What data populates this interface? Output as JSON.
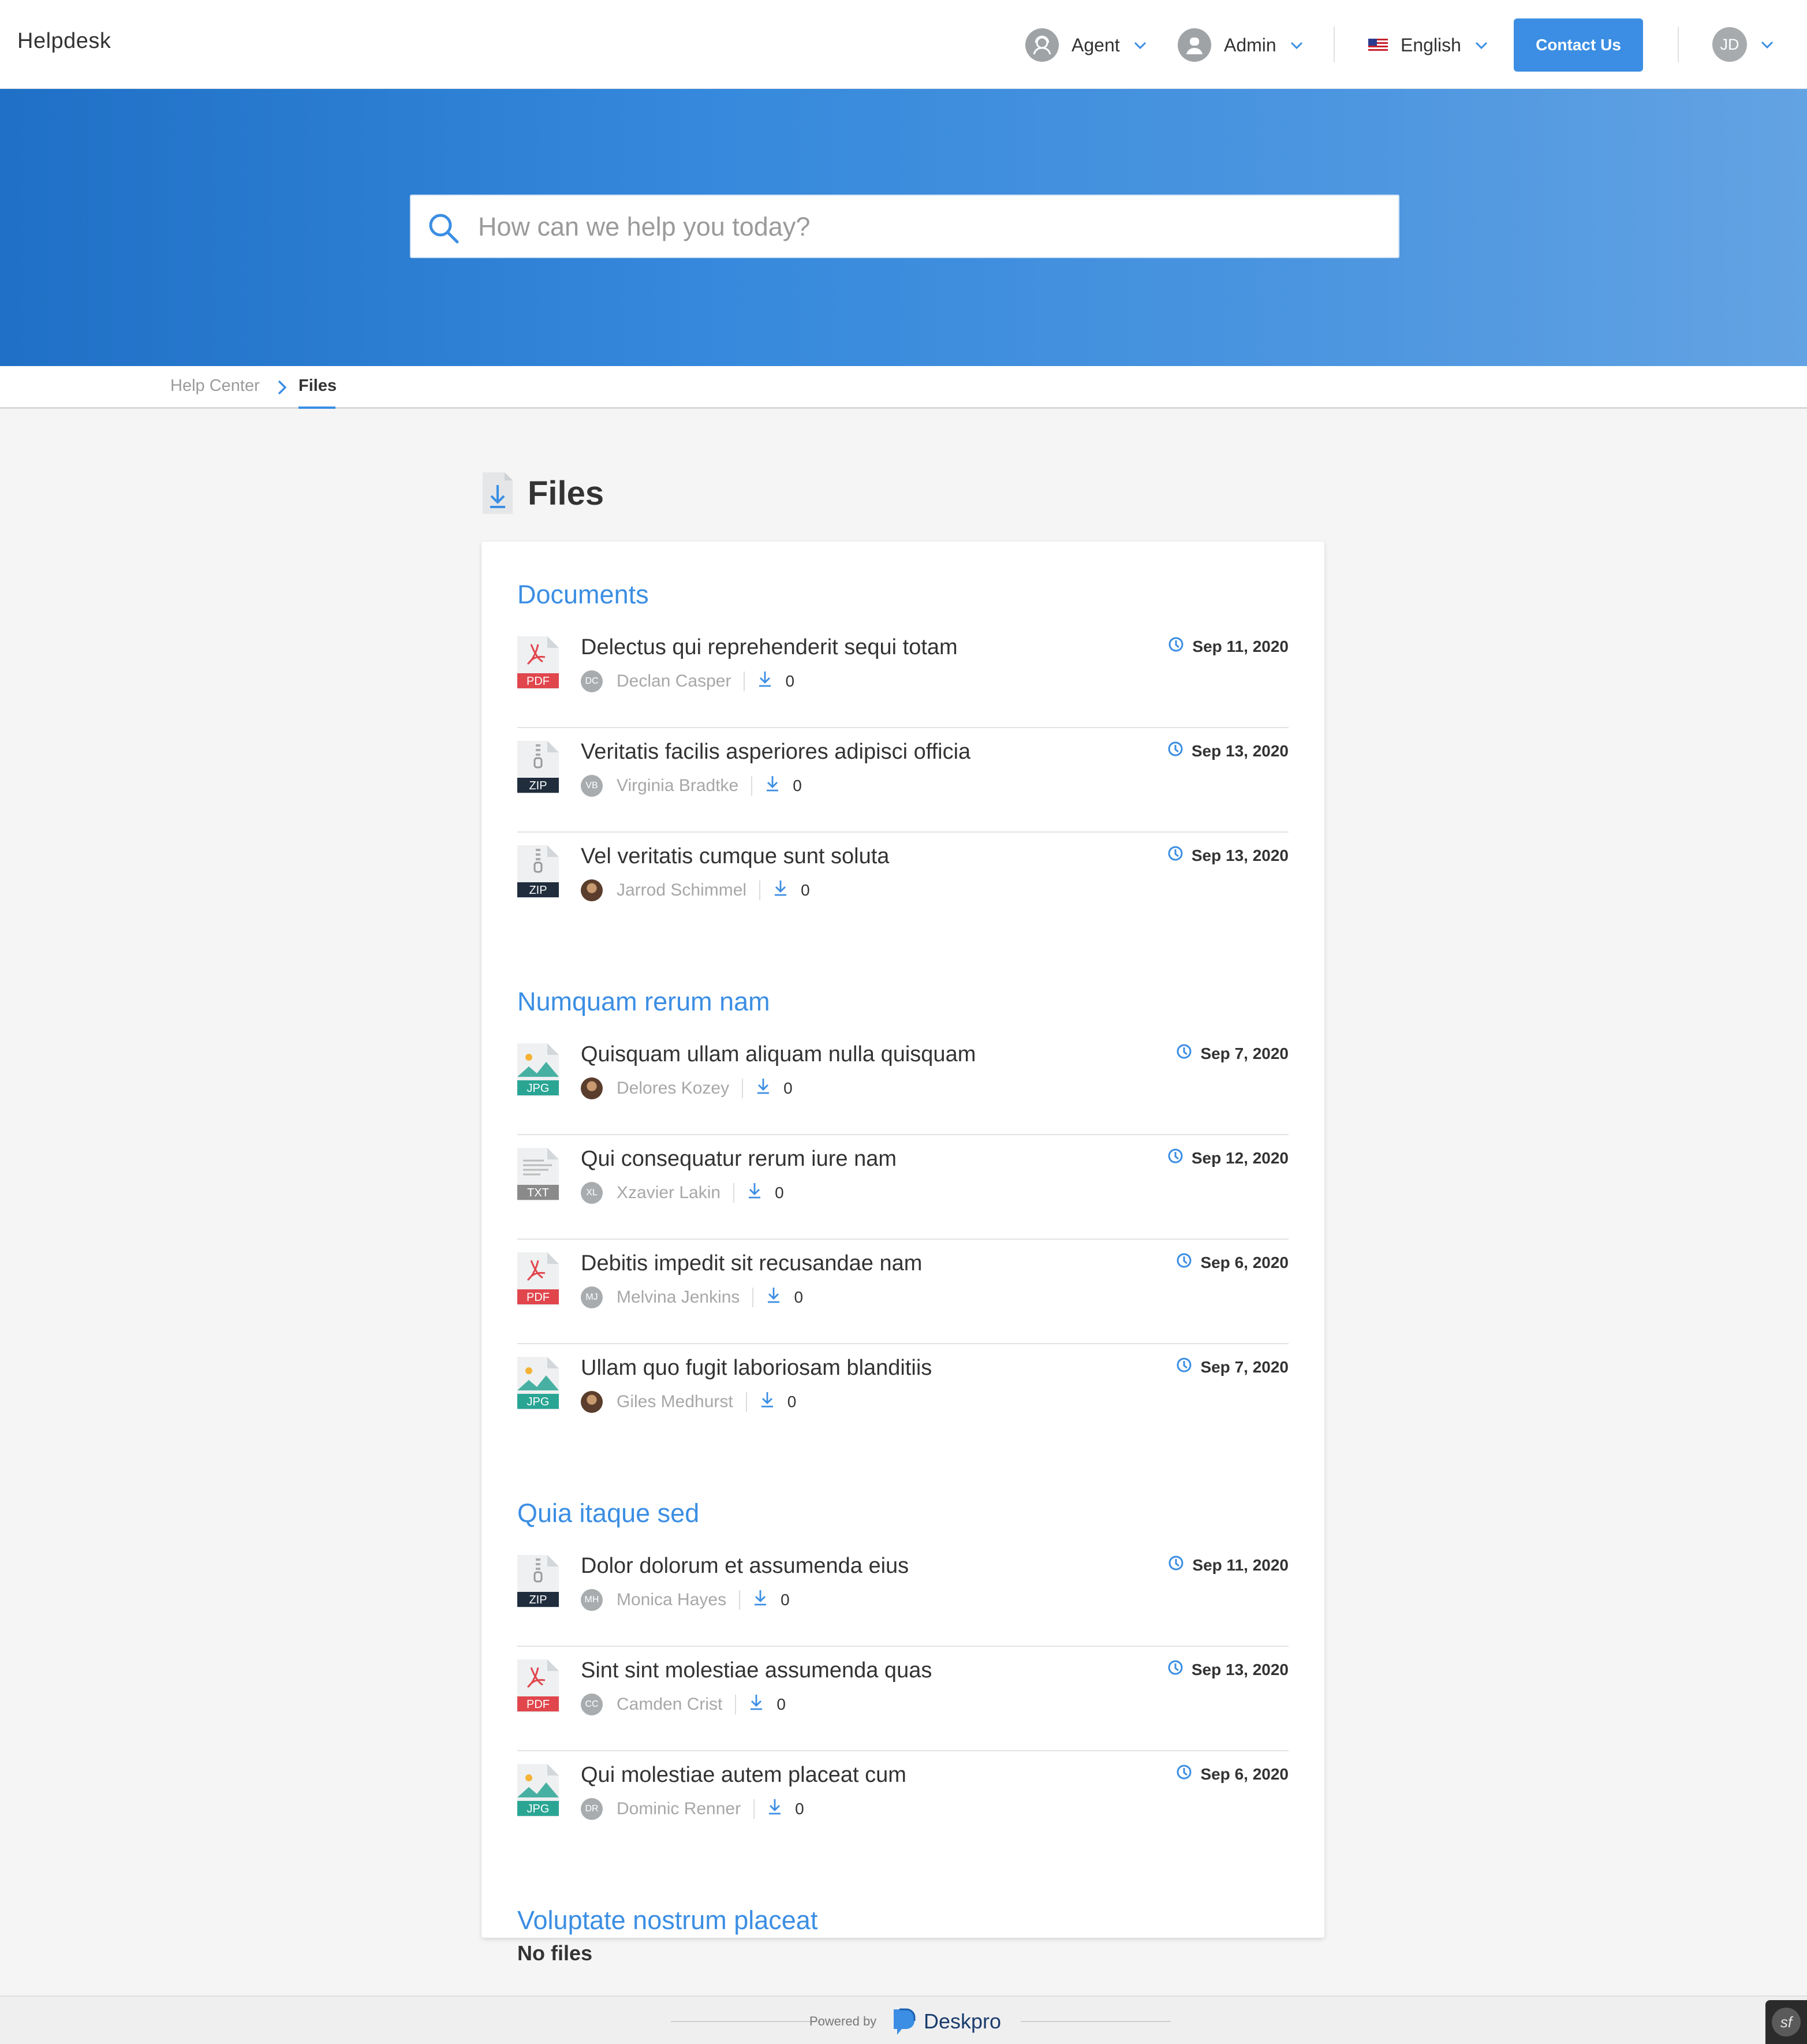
{
  "header": {
    "brand": "Helpdesk",
    "agent_label": "Agent",
    "admin_label": "Admin",
    "language_label": "English",
    "contact_label": "Contact Us",
    "user_initials": "JD"
  },
  "search": {
    "placeholder": "How can we help you today?"
  },
  "breadcrumb": {
    "home": "Help Center",
    "current": "Files"
  },
  "page": {
    "title": "Files"
  },
  "sections": [
    {
      "title": "Documents",
      "files": [
        {
          "title": "Delectus qui reprehenderit sequi totam",
          "type": "PDF",
          "author": "Declan Casper",
          "initials": "DC",
          "downloads": "0",
          "date": "Sep 11, 2020"
        },
        {
          "title": "Veritatis facilis asperiores adipisci officia",
          "type": "ZIP",
          "author": "Virginia Bradtke",
          "initials": "VB",
          "downloads": "0",
          "date": "Sep 13, 2020"
        },
        {
          "title": "Vel veritatis cumque sunt soluta",
          "type": "ZIP",
          "author": "Jarrod Schimmel",
          "initials": "",
          "downloads": "0",
          "date": "Sep 13, 2020"
        }
      ]
    },
    {
      "title": "Numquam rerum nam",
      "files": [
        {
          "title": "Quisquam ullam aliquam nulla quisquam",
          "type": "JPG",
          "author": "Delores Kozey",
          "initials": "",
          "downloads": "0",
          "date": "Sep 7, 2020"
        },
        {
          "title": "Qui consequatur rerum iure nam",
          "type": "TXT",
          "author": "Xzavier Lakin",
          "initials": "XL",
          "downloads": "0",
          "date": "Sep 12, 2020"
        },
        {
          "title": "Debitis impedit sit recusandae nam",
          "type": "PDF",
          "author": "Melvina Jenkins",
          "initials": "MJ",
          "downloads": "0",
          "date": "Sep 6, 2020"
        },
        {
          "title": "Ullam quo fugit laboriosam blanditiis",
          "type": "JPG",
          "author": "Giles Medhurst",
          "initials": "",
          "downloads": "0",
          "date": "Sep 7, 2020"
        }
      ]
    },
    {
      "title": "Quia itaque sed",
      "files": [
        {
          "title": "Dolor dolorum et assumenda eius",
          "type": "ZIP",
          "author": "Monica Hayes",
          "initials": "MH",
          "downloads": "0",
          "date": "Sep 11, 2020"
        },
        {
          "title": "Sint sint molestiae assumenda quas",
          "type": "PDF",
          "author": "Camden Crist",
          "initials": "CC",
          "downloads": "0",
          "date": "Sep 13, 2020"
        },
        {
          "title": "Qui molestiae autem placeat cum",
          "type": "JPG",
          "author": "Dominic Renner",
          "initials": "DR",
          "downloads": "0",
          "date": "Sep 6, 2020"
        }
      ]
    },
    {
      "title": "Voluptate nostrum placeat",
      "empty_label": "No files",
      "files": []
    }
  ],
  "footer": {
    "powered_by": "Powered by",
    "vendor": "Deskpro",
    "debug_badge": "sf"
  },
  "colors": {
    "accent": "#3b8ee3",
    "pdf": "#e0464c",
    "zip": "#1f2d3d",
    "jpg": "#2aa594",
    "txt": "#8a8a8a"
  }
}
